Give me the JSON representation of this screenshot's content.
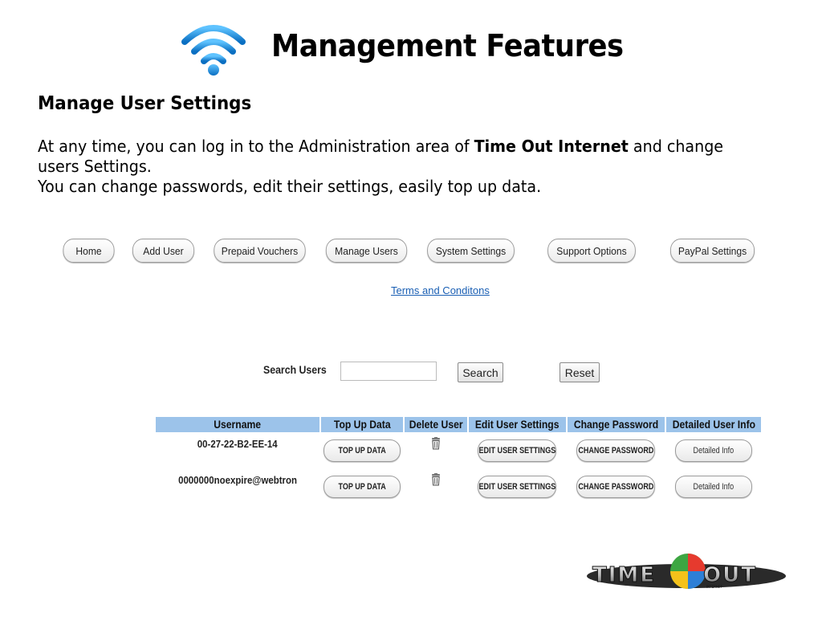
{
  "slide": {
    "title": "Management Features",
    "subtitle": "Manage User Settings",
    "para_before_bold": "At any time, you can log in to the Administration area of ",
    "para_bold": "Time Out Internet",
    "para_after_bold": " and change users Settings.",
    "para_line2": "You can change passwords, edit their settings, easily top up data."
  },
  "nav": {
    "home": "Home",
    "add_user": "Add User",
    "prepaid_vouchers": "Prepaid Vouchers",
    "manage_users": "Manage Users",
    "system_settings": "System Settings",
    "support_options": "Support Options",
    "paypal_settings": "PayPal Settings"
  },
  "terms_link": "Terms and Conditons",
  "search": {
    "label": "Search Users",
    "value": "",
    "search_button": "Search",
    "reset_button": "Reset"
  },
  "table": {
    "headers": {
      "username": "Username",
      "top_up": "Top Up Data",
      "delete": "Delete User",
      "edit": "Edit User Settings",
      "change_password": "Change Password",
      "detailed": "Detailed User Info"
    },
    "rows": [
      {
        "username": "00-27-22-B2-EE-14",
        "top_up_label": "TOP UP DATA",
        "edit_label": "EDIT USER SETTINGS",
        "password_label": "CHANGE PASSWORD",
        "detail_label": "Detailed Info"
      },
      {
        "username": "0000000noexpire@webtron",
        "top_up_label": "TOP UP DATA",
        "edit_label": "EDIT USER SETTINGS",
        "password_label": "CHANGE PASSWORD",
        "detail_label": "Detailed Info"
      }
    ]
  },
  "icons": {
    "wifi": "wifi-icon",
    "delete": "trash-icon",
    "logo": "time-out-logo"
  },
  "logo": {
    "text_left": "TIME",
    "text_right": "OUT",
    "small_text": "INTERNET"
  },
  "colors": {
    "header_bg": "#9cc3ea",
    "wifi_blue": "#1a8fe0",
    "link": "#1a5fb4"
  }
}
